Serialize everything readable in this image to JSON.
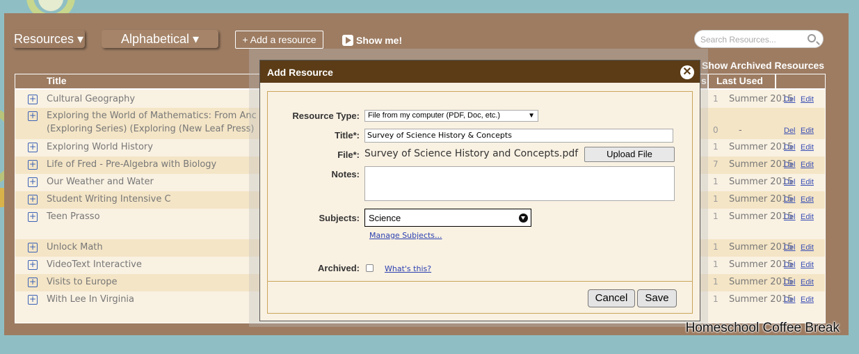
{
  "toolbar": {
    "resources_label": "Resources ▾",
    "alphabetical_label": "Alphabetical ▾",
    "add_label": "+ Add a resource",
    "show_me_label": "Show me!",
    "search_placeholder": "Search Resources..."
  },
  "show_archived_label": "Show Archived Resources",
  "table": {
    "headers": {
      "title": "Title",
      "last_used": "Last Used",
      "partial_col": "s"
    },
    "rows": [
      {
        "title": "Cultural Geography",
        "num": "1",
        "last_used": "Summer 2015",
        "del": "Del",
        "edit": "Edit"
      },
      {
        "title": "Exploring the World of Mathematics: From Anc",
        "title2": "(Exploring Series) (Exploring (New Leaf Press)",
        "num": "0",
        "last_used": "-",
        "del": "Del",
        "edit": "Edit"
      },
      {
        "title": "Exploring World History",
        "num": "1",
        "last_used": "Summer 2015",
        "del": "Del",
        "edit": "Edit"
      },
      {
        "title": "Life of Fred - Pre-Algebra with Biology",
        "num": "7",
        "last_used": "Summer 2015",
        "del": "Del",
        "edit": "Edit"
      },
      {
        "title": "Our Weather and Water",
        "num": "1",
        "last_used": "Summer 2015",
        "del": "Del",
        "edit": "Edit"
      },
      {
        "title": "Student Writing Intensive C",
        "num": "1",
        "last_used": "Summer 2015",
        "del": "Del",
        "edit": "Edit"
      },
      {
        "title": "Teen Prasso",
        "num": "1",
        "last_used": "Summer 2015",
        "del": "Del",
        "edit": "Edit"
      },
      {
        "title": "Unlock Math",
        "num": "1",
        "last_used": "Summer 2015",
        "del": "Del",
        "edit": "Edit"
      },
      {
        "title": "VideoText Interactive",
        "num": "1",
        "last_used": "Summer 2015",
        "del": "Del",
        "edit": "Edit"
      },
      {
        "title": "Visits to Europe",
        "num": "1",
        "last_used": "Summer 2015",
        "del": "Del",
        "edit": "Edit"
      },
      {
        "title": "With Lee In Virginia",
        "num": "1",
        "last_used": "Summer 2015",
        "del": "Del",
        "edit": "Edit"
      }
    ]
  },
  "modal": {
    "title": "Add Resource",
    "close_glyph": "✕",
    "resource_type_label": "Resource Type:",
    "resource_type_value": "File from my computer (PDF, Doc, etc.)",
    "title_label": "Title*:",
    "title_value": "Survey of Science History & Concepts",
    "file_label": "File*:",
    "file_value": "Survey of Science History and Concepts.pdf",
    "upload_label": "Upload File",
    "notes_label": "Notes:",
    "notes_value": "",
    "subjects_label": "Subjects:",
    "subjects_value": "Science",
    "manage_subjects_label": "Manage Subjects...",
    "archived_label": "Archived:",
    "whats_this_label": "What's this?",
    "cancel_label": "Cancel",
    "save_label": "Save"
  },
  "watermark": "Homeschool Coffee Break"
}
